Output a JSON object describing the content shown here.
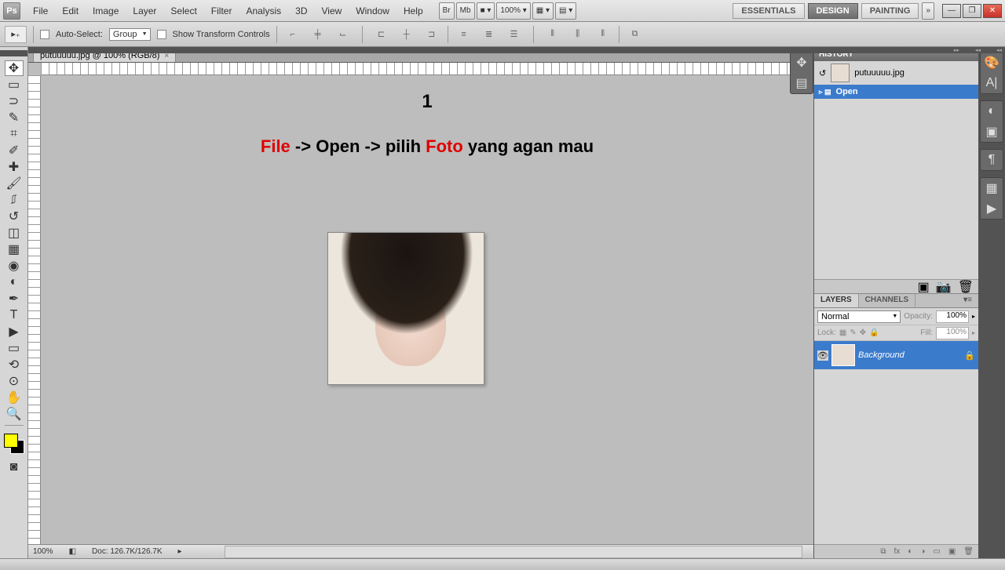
{
  "app": {
    "logo": "Ps"
  },
  "menu": [
    "File",
    "Edit",
    "Image",
    "Layer",
    "Select",
    "Filter",
    "Analysis",
    "3D",
    "View",
    "Window",
    "Help"
  ],
  "menubar_extras": {
    "br": "Br",
    "mb": "Mb",
    "screen": "■ ▾",
    "zoom": "100% ▾",
    "grid": "▦ ▾",
    "doc": "▤ ▾",
    "expand": "»"
  },
  "workspaces": [
    "ESSENTIALS",
    "DESIGN",
    "PAINTING"
  ],
  "options": {
    "autoselect_label": "Auto-Select:",
    "autoselect_value": "Group",
    "show_tc": "Show Transform Controls"
  },
  "doc": {
    "tab": "putuuuuu.jpg @ 100% (RGB/8)",
    "zoom": "100%",
    "docinfo": "Doc: 126.7K/126.7K"
  },
  "overlay": {
    "step": "1",
    "file": "File",
    "arrow1": " -> Open -> pilih ",
    "foto": "Foto",
    "rest": " yang agan mau"
  },
  "history": {
    "title": "HISTORY",
    "source": "putuuuuu.jpg",
    "state": "Open"
  },
  "layers": {
    "tab1": "LAYERS",
    "tab2": "CHANNELS",
    "blend": "Normal",
    "opacity_label": "Opacity:",
    "opacity": "100%",
    "lock_label": "Lock:",
    "fill_label": "Fill:",
    "fill": "100%",
    "bg": "Background"
  }
}
